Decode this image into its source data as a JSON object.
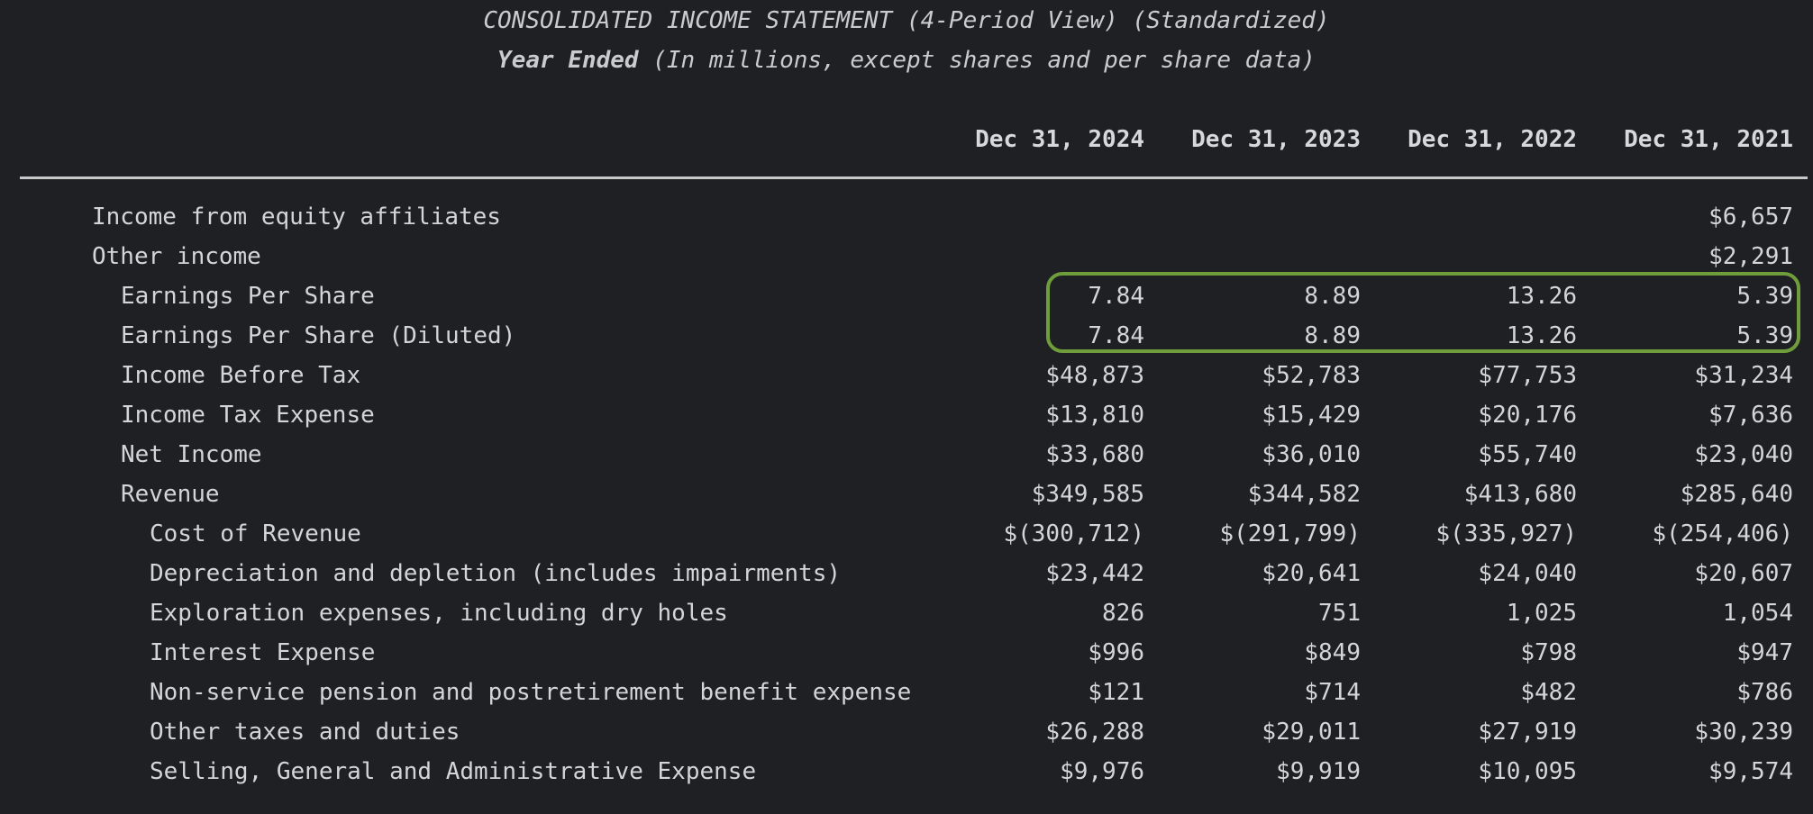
{
  "header": {
    "title": "CONSOLIDATED INCOME STATEMENT (4-Period View) (Standardized)",
    "subtitle_bold": "Year Ended",
    "subtitle_rest": " (In millions, except shares and per share data)"
  },
  "columns": [
    "Dec 31, 2024",
    "Dec 31, 2023",
    "Dec 31, 2022",
    "Dec 31, 2021"
  ],
  "rows": [
    {
      "label": "Income from equity affiliates",
      "indent": 0,
      "values": [
        "",
        "",
        "",
        "$6,657"
      ]
    },
    {
      "label": "Other income",
      "indent": 0,
      "values": [
        "",
        "",
        "",
        "$2,291"
      ]
    },
    {
      "label": "Earnings Per Share",
      "indent": 1,
      "values": [
        "7.84",
        "8.89",
        "13.26",
        "5.39"
      ]
    },
    {
      "label": "Earnings Per Share (Diluted)",
      "indent": 1,
      "values": [
        "7.84",
        "8.89",
        "13.26",
        "5.39"
      ]
    },
    {
      "label": "Income Before Tax",
      "indent": 1,
      "values": [
        "$48,873",
        "$52,783",
        "$77,753",
        "$31,234"
      ]
    },
    {
      "label": "Income Tax Expense",
      "indent": 1,
      "values": [
        "$13,810",
        "$15,429",
        "$20,176",
        "$7,636"
      ]
    },
    {
      "label": "Net Income",
      "indent": 1,
      "values": [
        "$33,680",
        "$36,010",
        "$55,740",
        "$23,040"
      ]
    },
    {
      "label": "Revenue",
      "indent": 1,
      "values": [
        "$349,585",
        "$344,582",
        "$413,680",
        "$285,640"
      ]
    },
    {
      "label": "Cost of Revenue",
      "indent": 2,
      "values": [
        "$(300,712)",
        "$(291,799)",
        "$(335,927)",
        "$(254,406)"
      ]
    },
    {
      "label": "Depreciation and depletion (includes impairments)",
      "indent": 2,
      "values": [
        "$23,442",
        "$20,641",
        "$24,040",
        "$20,607"
      ]
    },
    {
      "label": "Exploration expenses, including dry holes",
      "indent": 2,
      "values": [
        "826",
        "751",
        "1,025",
        "1,054"
      ]
    },
    {
      "label": "Interest Expense",
      "indent": 2,
      "values": [
        "$996",
        "$849",
        "$798",
        "$947"
      ]
    },
    {
      "label": "Non-service pension and postretirement benefit expense",
      "indent": 2,
      "values": [
        "$121",
        "$714",
        "$482",
        "$786"
      ]
    },
    {
      "label": "Other taxes and duties",
      "indent": 2,
      "values": [
        "$26,288",
        "$29,011",
        "$27,919",
        "$30,239"
      ]
    },
    {
      "label": "Selling, General and Administrative Expense",
      "indent": 2,
      "values": [
        "$9,976",
        "$9,919",
        "$10,095",
        "$9,574"
      ]
    }
  ],
  "highlight": {
    "color": "#6f9d3c"
  }
}
